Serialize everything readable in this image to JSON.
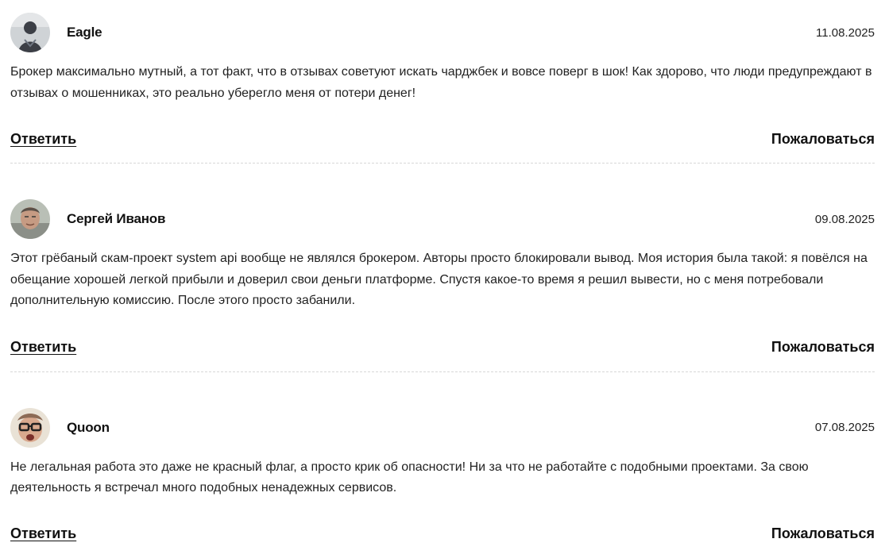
{
  "comments": [
    {
      "author": "Eagle",
      "date": "11.08.2025",
      "text": "Брокер максимально мутный, а тот факт, что в отзывах советуют искать чарджбек и вовсе поверг в шок! Как здорово, что люди предупреждают в отзывах о мошенниках, это реально уберегло меня от потери денег!",
      "avatar_colors": {
        "bg": "#cfd3d6",
        "figure": "#3c3f46",
        "accent": "#6f7682"
      }
    },
    {
      "author": "Сергей Иванов",
      "date": "09.08.2025",
      "text": "Этот грёбаный скам-проект system api вообще не являлся брокером. Авторы просто блокировали вывод. Моя история была такой: я повёлся на обещание хорошей легкой прибыли и доверил свои деньги платформе. Спустя какое-то время я решил вывести, но с меня потребовали дополнительную комиссию. После этого просто забанили.",
      "avatar_colors": {
        "bg": "#b9bfb6",
        "figure": "#c69b83",
        "accent": "#5b5048"
      }
    },
    {
      "author": "Quoon",
      "date": "07.08.2025",
      "text": "Не легальная работа это даже не красный флаг, а просто крик об опасности! Ни за что не работайте с подобными проектами. За свою деятельность я встречал много подобных ненадежных сервисов.",
      "avatar_colors": {
        "bg": "#e9e2d6",
        "figure": "#d9a98e",
        "accent": "#202020"
      }
    }
  ],
  "actions": {
    "reply_label": "Ответить",
    "report_label": "Пожаловаться"
  }
}
